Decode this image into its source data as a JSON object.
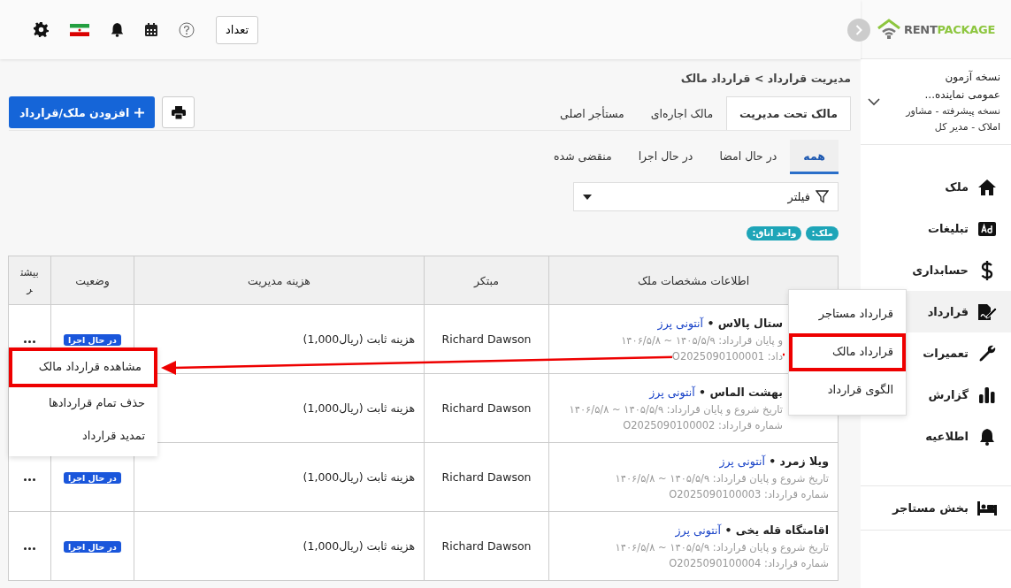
{
  "brand": {
    "text": "RENT",
    "accent": "PACKAGE"
  },
  "topbar": {
    "count_button": "تعداد"
  },
  "user": {
    "title": "نسخه آزمون عمومی نماینده...",
    "role": "نسخه پیشرفته - مشاور املاک - مدیر کل"
  },
  "sidebar": {
    "items": [
      {
        "label": "ملک",
        "selected": false
      },
      {
        "label": "تبلیغات",
        "selected": false
      },
      {
        "label": "حسابداری",
        "selected": false
      },
      {
        "label": "قرارداد",
        "selected": true
      },
      {
        "label": "تعمیرات",
        "selected": false
      },
      {
        "label": "گزارش",
        "selected": false
      },
      {
        "label": "اطلاعیه",
        "selected": false
      }
    ],
    "tenant_section": "بخش مستاجر"
  },
  "nav_submenu": [
    {
      "label": "قرارداد مستاجر",
      "highlighted": false
    },
    {
      "label": "قرارداد مالک",
      "highlighted": true
    },
    {
      "label": "الگوی قرارداد",
      "highlighted": false
    }
  ],
  "breadcrumb": "مدیریت قرارداد > قرارداد مالک",
  "tabs": [
    {
      "label": "مالک تحت مدیریت",
      "selected": true
    },
    {
      "label": "مالک اجاره‌ای",
      "selected": false
    },
    {
      "label": "مستأجر اصلی",
      "selected": false
    }
  ],
  "add_button": "افزودن ملک/قرارداد",
  "status_tabs": [
    {
      "label": "همه",
      "selected": true
    },
    {
      "label": "در حال امضا",
      "selected": false
    },
    {
      "label": "در حال اجرا",
      "selected": false
    },
    {
      "label": "منقضی شده",
      "selected": false
    }
  ],
  "filter": {
    "label": "فیلتر"
  },
  "chips": [
    "ملک:",
    "واحد اتاق:"
  ],
  "table": {
    "columns": [
      "اطلاعات مشخصات ملک",
      "مبتکر",
      "هزینه مدیریت",
      "وضعیت",
      "بیشتر"
    ],
    "rows": [
      {
        "name": "ستال پالاس •",
        "owner": "آنتونی پرز",
        "dates": "و پایان قرارداد: ۱۴۰۵/۵/۹ ~ ۱۴۰۶/۵/۸",
        "number": "داد: O2025090100001",
        "initiator": "Richard Dawson",
        "fee": "هزینه ثابت (ریال1,000)",
        "status": "در حال اجرا",
        "more": true
      },
      {
        "name": "بهشت الماس •",
        "owner": "آنتونی پرز",
        "dates": "تاریخ شروع و پایان قرارداد: ۱۴۰۵/۵/۹ ~ ۱۴۰۶/۵/۸",
        "number": "شماره قرارداد: O2025090100002",
        "initiator": "Richard Dawson",
        "fee": "هزینه ثابت (ریال1,000)"
      },
      {
        "name": "ویلا زمرد •",
        "owner": "آنتونی پرز",
        "dates": "تاریخ شروع و پایان قرارداد: ۱۴۰۵/۵/۹ ~ ۱۴۰۶/۵/۸",
        "number": "شماره قرارداد: O2025090100003",
        "initiator": "Richard Dawson",
        "fee": "هزینه ثابت (ریال1,000)",
        "status": "در حال اجرا",
        "more": true
      },
      {
        "name": "اقامتگاه قله یخی •",
        "owner": "آنتونی پرز",
        "dates": "تاریخ شروع و پایان قرارداد: ۱۴۰۵/۵/۹ ~ ۱۴۰۶/۵/۸",
        "number": "شماره قرارداد: O2025090100004",
        "initiator": "Richard Dawson",
        "fee": "هزینه ثابت (ریال1,000)",
        "status": "در حال اجرا",
        "more": true
      }
    ]
  },
  "row_menu": [
    {
      "label": "مشاهده قرارداد مالک",
      "highlighted": true
    },
    {
      "label": "حذف تمام قراردادها",
      "highlighted": false
    },
    {
      "label": "تمدید قرارداد",
      "highlighted": false
    }
  ]
}
